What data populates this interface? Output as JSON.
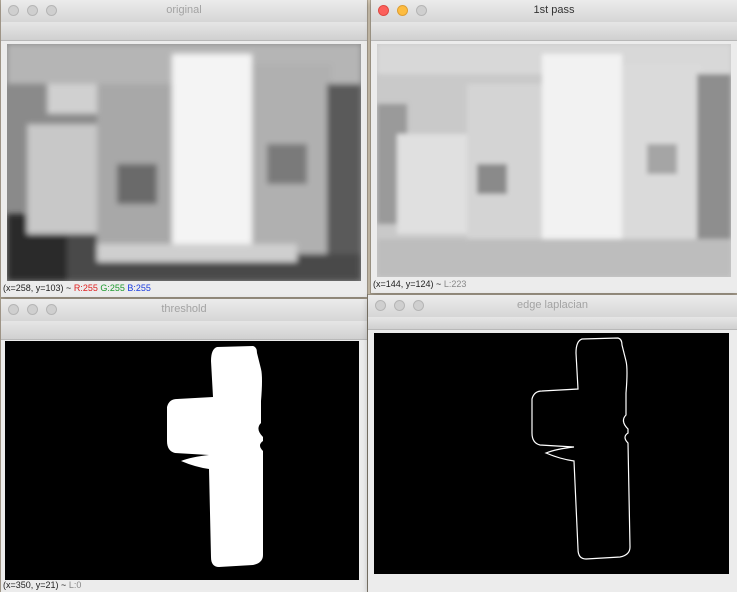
{
  "windows": {
    "original": {
      "title": "original",
      "status": {
        "coords": "(x=258, y=103) ~",
        "r": "R:255",
        "g": "G:255",
        "b": "B:255"
      }
    },
    "first_pass": {
      "title": "1st pass",
      "status": {
        "coords": "(x=144, y=124) ~",
        "value": "L:223"
      }
    },
    "threshold": {
      "title": "threshold",
      "status": {
        "coords": "(x=350, y=21) ~",
        "value": "L:0"
      }
    },
    "edge": {
      "title": "edge laplacian"
    }
  },
  "colors": {
    "close": "#fc605c",
    "minimize": "#fdbc40",
    "canvas_bg": "#000000",
    "mask_fg": "#ffffff"
  },
  "icons": [
    "close-icon",
    "minimize-icon",
    "zoom-icon"
  ]
}
